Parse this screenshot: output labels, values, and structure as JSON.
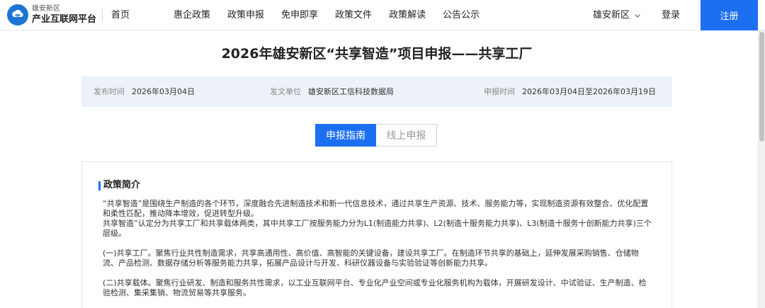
{
  "header": {
    "logo_sub": "雄安新区",
    "logo_main": "产业互联网平台",
    "home": "首页",
    "nav": [
      "惠企政策",
      "政策申报",
      "免申即享",
      "政策文件",
      "政策解读",
      "公告公示"
    ],
    "region": "雄安新区",
    "login": "登录",
    "register": "注册"
  },
  "page": {
    "title": "2026年雄安新区“共享智造”项目申报——共享工厂"
  },
  "meta": {
    "publish_label": "发布时间",
    "publish_value": "2026年03月04日",
    "issuer_label": "发文单位",
    "issuer_value": "雄安新区工信科技数据局",
    "period_label": "申报时间",
    "period_value": "2026年03月04日至2026年03月19日"
  },
  "tabs": [
    "申报指南",
    "线上申报"
  ],
  "content": {
    "section_title": "政策简介",
    "p1": "“共享智造”是围绕生产制造的各个环节，深度融合先进制造技术和新一代信息技术，通过共享生产资源、技术、服务能力等，实现制造资源有效整合、优化配置和柔性匹配，推动降本增效，促进转型升级。",
    "p2": "共享智造”认定分为共享工厂和共享载体两类，其中共享工厂按服务能力分为L1(制造能力共享)、L2(制造十服务能力共享)、L3(制造十服务十创新能力共享)三个层级。",
    "p3": "(一)共享工厂。聚焦行业共性制造需求，共享高通用性、高价值、高智能的关键设备，建设共享工厂。在制造环节共享的基础上，延伸发展采购销售、仓储物流、产品检测、数据存储分析等服务能力共享，拓展产品设计与开发、科研仪器设备与实验验证等创新能力共享。",
    "p4": "(二)共享载体。聚焦行业研发、制造和服务共性需求，以工业互联网平台、专业化产业空间或专业化服务机构为载体，开展研发设计、中试验证、生产制造、检验检测、集采集销、物流贸易等共享服务。"
  },
  "colors": {
    "primary": "#1d6ff2",
    "meta_bg": "#edf2f9"
  }
}
